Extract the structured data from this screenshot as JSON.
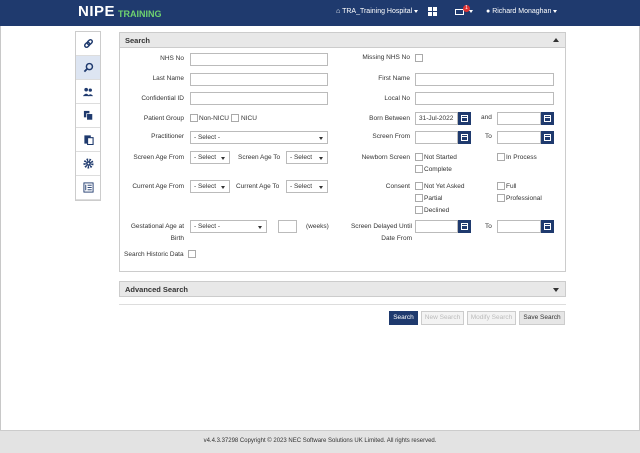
{
  "header": {
    "brand": "NIPE",
    "brand_sub": "TRAINING",
    "hospital": "TRA_Training Hospital",
    "notification_count": "1",
    "user": "Richard Monaghan"
  },
  "sidebar": {
    "items": [
      "link-icon",
      "search-icon",
      "users-icon",
      "copy-icon",
      "clipboard-icon",
      "gear-icon",
      "list-icon"
    ]
  },
  "search": {
    "title": "Search",
    "labels": {
      "nhs_no": "NHS No",
      "missing_nhs": "Missing NHS No",
      "last_name": "Last Name",
      "first_name": "First Name",
      "confidential_id": "Confidential ID",
      "local_no": "Local No",
      "patient_group": "Patient Group",
      "non_nicu": "Non-NICU",
      "nicu": "NICU",
      "born_between": "Born Between",
      "and": "and",
      "practitioner": "Practitioner",
      "screen_from": "Screen From",
      "to": "To",
      "screen_age_from": "Screen Age From",
      "screen_age_to": "Screen Age To",
      "newborn_screen": "Newborn Screen",
      "not_started": "Not Started",
      "in_process": "In Process",
      "complete": "Complete",
      "current_age_from": "Current Age From",
      "current_age_to": "Current Age To",
      "consent": "Consent",
      "not_yet_asked": "Not Yet Asked",
      "full": "Full",
      "partial": "Partial",
      "professional": "Professional",
      "declined": "Declined",
      "gestational_age_1": "Gestational Age at",
      "gestational_age_2": "Birth",
      "weeks": "(weeks)",
      "screen_delayed_1": "Screen Delayed Until",
      "screen_delayed_2": "Date From",
      "search_historic": "Search Historic Data"
    },
    "values": {
      "born_from": "31-Jul-2022",
      "select": "- Select -",
      "select_short": "- Select"
    }
  },
  "advanced": {
    "title": "Advanced Search"
  },
  "buttons": {
    "search": "Search",
    "new_search": "New Search",
    "modify_search": "Modify Search",
    "save_search": "Save Search"
  },
  "footer": {
    "text": "v4.4.3.37298 Copyright © 2023 NEC Software Solutions UK Limited. All rights reserved."
  },
  "colors": {
    "navbar": "#1f3a6e",
    "brand_sub": "#6fd26f",
    "badge": "#dd3333"
  }
}
